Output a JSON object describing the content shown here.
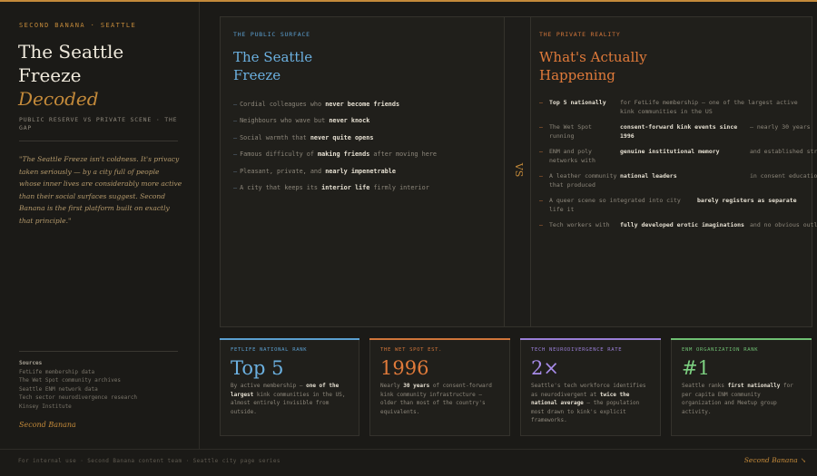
{
  "brand": "SECOND BANANA · SEATTLE",
  "title": {
    "line1": "The Seattle",
    "line2": "Freeze",
    "line3": "Decoded"
  },
  "subtitle": "PUBLIC RESERVE VS PRIVATE SCENE · THE GAP",
  "quote": "\"The Seattle Freeze isn't coldness. It's privacy taken seriously — by a city full of people whose inner lives are considerably more active than their social surfaces suggest. Second Banana is the first platform built on exactly that principle.\"",
  "sources": {
    "heading": "Sources",
    "items": [
      "FetLife membership data",
      "The Wet Spot community archives",
      "Seattle ENM network data",
      "Tech sector neurodivergence research",
      "Kinsey Institute"
    ]
  },
  "signature": "Second Banana",
  "public": {
    "label": "THE PUBLIC SURFACE",
    "title_line1": "The Seattle",
    "title_line2": "Freeze",
    "items": [
      {
        "pre": "Cordial colleagues who ",
        "bold": "never become friends",
        "post": ""
      },
      {
        "pre": "Neighbours who wave but ",
        "bold": "never knock",
        "post": ""
      },
      {
        "pre": "Social warmth that ",
        "bold": "never quite opens",
        "post": ""
      },
      {
        "pre": "Famous difficulty of ",
        "bold": "making friends",
        "post": " after moving here"
      },
      {
        "pre": "Pleasant, private, and ",
        "bold": "nearly impenetrable",
        "post": ""
      },
      {
        "pre": "A city that keeps its ",
        "bold": "interior life",
        "post": " firmly interior"
      }
    ]
  },
  "divider_mark": "VS",
  "private": {
    "label": "THE PRIVATE REALITY",
    "title_line1": "What's Actually",
    "title_line2": "Happening",
    "items": [
      {
        "a": "Top 5 nationally",
        "b": "for FetLife membership — one of the largest active kink communities in the US",
        "c": "",
        "a_bold": true,
        "b_bold": false
      },
      {
        "a": "The Wet Spot running",
        "b": "consent-forward kink events since 1996",
        "c": "— nearly 30 years",
        "a_bold": false,
        "b_bold": true
      },
      {
        "a": "ENM and poly networks with",
        "b": "genuine institutional memory",
        "c": "and established structure",
        "a_bold": false,
        "b_bold": true
      },
      {
        "a": "A leather community that produced",
        "b": "national leaders",
        "c": "in consent education",
        "a_bold": false,
        "b_bold": true
      },
      {
        "a": "A queer scene so integrated into city life it",
        "b": "barely registers as separate",
        "c": "",
        "a_bold": false,
        "b_bold": true
      },
      {
        "a": "Tech workers with",
        "b": "fully developed erotic imaginations",
        "c": "and no obvious outlet",
        "a_bold": false,
        "b_bold": true
      }
    ]
  },
  "cards": [
    {
      "label": "FETLIFE NATIONAL RANK",
      "value": "Top 5",
      "d1": "By active membership — ",
      "db": "one of the largest",
      "d2": " kink communities in the US, almost entirely invisible from outside.",
      "color": "#5b9fd0"
    },
    {
      "label": "THE WET SPOT EST.",
      "value": "1996",
      "d1": "Nearly ",
      "db": "30 years",
      "d2": " of consent-forward kink community infrastructure — older than most of the country's equivalents.",
      "color": "#d0753a"
    },
    {
      "label": "TECH NEURODIVERGENCE RATE",
      "value": "2×",
      "d1": "Seattle's tech workforce identifies as neurodivergent at ",
      "db": "twice the national average",
      "d2": " — the population most drawn to kink's explicit frameworks.",
      "color": "#9a7fd8"
    },
    {
      "label": "ENM ORGANIZATION RANK",
      "value": "#1",
      "d1": "Seattle ranks ",
      "db": "first nationally",
      "d2": " for per capita ENM community organization and Meetup group activity.",
      "color": "#6fbf73"
    }
  ],
  "footer": "For internal use · Second Banana content team · Seattle city page series",
  "footer_signature": "Second Banana",
  "footer_icon": "banana-icon"
}
